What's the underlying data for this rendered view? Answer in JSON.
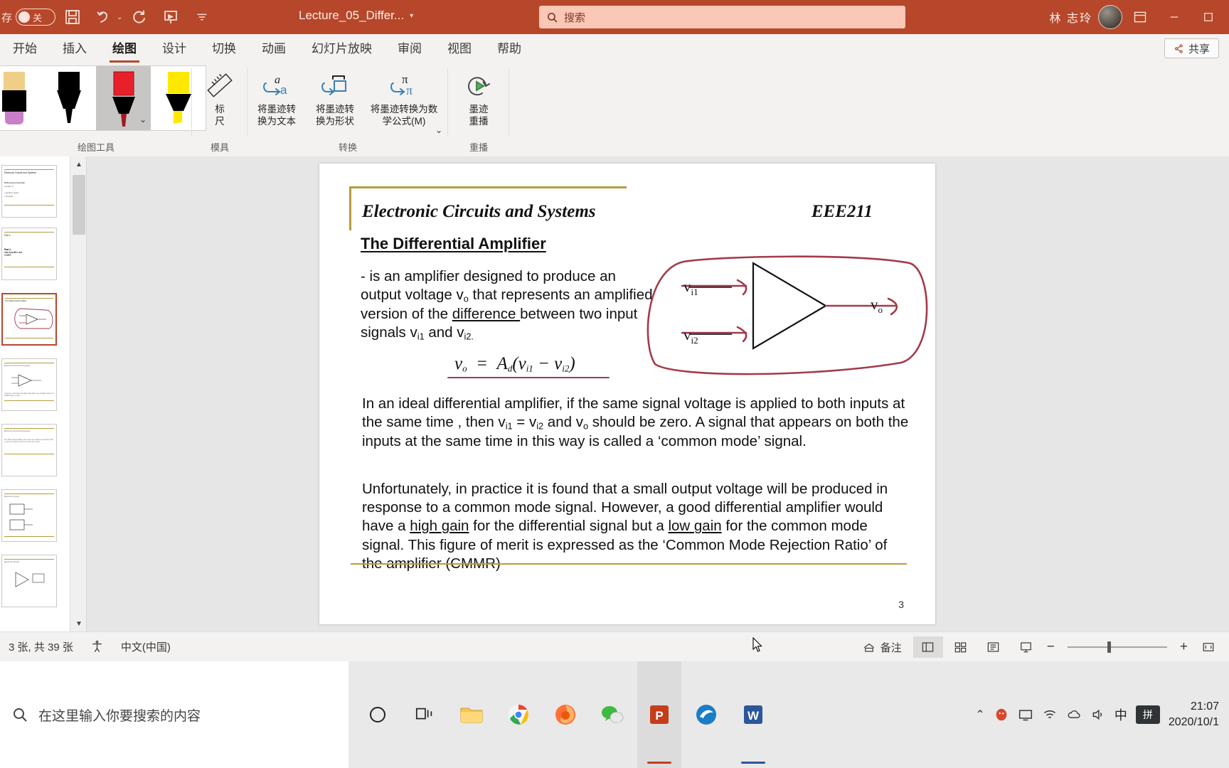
{
  "titlebar": {
    "autosave_label": "存",
    "autosave_state": "关",
    "doc_title": "Lecture_05_Differ...",
    "search_placeholder": "搜索",
    "user_name": "林 志玲",
    "icons": [
      "save-icon",
      "undo-icon",
      "redo-icon",
      "present-icon",
      "customize-qat-icon"
    ],
    "window_buttons": [
      "restore-ribbon",
      "minimize",
      "maximize"
    ]
  },
  "tabs": [
    {
      "label": "开始",
      "active": false
    },
    {
      "label": "插入",
      "active": false
    },
    {
      "label": "绘图",
      "active": true
    },
    {
      "label": "设计",
      "active": false
    },
    {
      "label": "切换",
      "active": false
    },
    {
      "label": "动画",
      "active": false
    },
    {
      "label": "幻灯片放映",
      "active": false
    },
    {
      "label": "审阅",
      "active": false
    },
    {
      "label": "视图",
      "active": false
    },
    {
      "label": "帮助",
      "active": false
    }
  ],
  "share_button": "共享",
  "ribbon": {
    "groups": [
      {
        "name": "绘图工具"
      },
      {
        "name": "模具"
      },
      {
        "name": "转换"
      },
      {
        "name": "重播"
      }
    ],
    "pens": [
      {
        "name": "eraser",
        "color": "#c97fc8",
        "selected": false
      },
      {
        "name": "black-pen",
        "color": "#000000",
        "selected": false
      },
      {
        "name": "red-pen",
        "color": "#e8202a",
        "selected": true
      },
      {
        "name": "yellow-highlighter",
        "color": "#ffe800",
        "selected": false
      }
    ],
    "buttons": [
      {
        "label": "标\n尺",
        "icon": "ruler-icon"
      },
      {
        "label": "将墨迹转\n换为文本",
        "icon": "ink-to-text-icon"
      },
      {
        "label": "将墨迹转\n换为形状",
        "icon": "ink-to-shape-icon"
      },
      {
        "label": "将墨迹转换为数\n学公式(M)",
        "icon": "ink-to-math-icon"
      },
      {
        "label": "墨迹\n重播",
        "icon": "ink-replay-icon"
      }
    ]
  },
  "slide": {
    "header_left": "Electronic Circuits and Systems",
    "header_right": "EEE211",
    "heading": "The Differential Amplifier",
    "para1_html": "- is an amplifier designed to produce an output voltage v<sub>o</sub> that represents an amplified version of the <span class=\"u\">difference </span>between two input signals v<sub>i1</sub> and v<sub>i2.</sub>",
    "formula_html": "v<sub>o</sub> &nbsp;= &nbsp;A<sub>d</sub>(v<sub>i1</sub> &minus; v<sub>i2</sub>)",
    "para2_html": "In an ideal differential amplifier, if the same signal voltage is applied to both inputs at the same time , then v<sub>i1</sub> = v<sub>i2</sub> and v<sub>o</sub> should be zero. A signal that appears on both the inputs at the same time in this way is called a &lsquo;common mode&rsquo; signal.",
    "para3_html": "Unfortunately, in practice it is found that a small output voltage will be produced in response to a common mode signal. However, a good differential amplifier would have a <span class=\"u\">high gain</span> for the differential signal but a <span class=\"u\">low gain</span> for the common mode signal. This figure of merit is expressed as the &lsquo;Common Mode Rejection Ratio&rsquo; of the amplifier (CMMR)",
    "page_number": "3",
    "ink_labels": [
      "v",
      "i1",
      "v",
      "i2",
      "v",
      "o"
    ],
    "accent_color": "#b79c3e",
    "ink_color": "#a33b4a"
  },
  "thumbnails": [
    {
      "index": 1,
      "title": "Electronic Circuits and Systems",
      "selected": false
    },
    {
      "index": 2,
      "title": "Part 1:",
      "subtitle": "Differential Amplifier and CMRR",
      "selected": false
    },
    {
      "index": 3,
      "title": "The Differential Amplifier",
      "selected": true
    },
    {
      "index": 4,
      "title": "",
      "selected": false
    },
    {
      "index": 5,
      "title": "",
      "selected": false
    },
    {
      "index": 6,
      "title": "",
      "selected": false
    },
    {
      "index": 7,
      "title": "",
      "selected": false
    }
  ],
  "status": {
    "slide_count": "3 张, 共 39 张",
    "accessibility_icon": "accessibility-icon",
    "language": "中文(中国)",
    "notes_label": "备注",
    "views": [
      "normal-view",
      "slide-sorter-view",
      "reading-view",
      "slideshow-view"
    ],
    "zoom_out": "−",
    "zoom_in": "+",
    "fit_icon": "fit-slide-icon"
  },
  "taskbar": {
    "search_placeholder": "在这里输入你要搜索的内容",
    "apps": [
      {
        "name": "cortana",
        "label": "Cortana"
      },
      {
        "name": "task-view",
        "label": "任务视图"
      },
      {
        "name": "file-explorer",
        "label": "文件资源管理器"
      },
      {
        "name": "chrome",
        "label": "Google Chrome"
      },
      {
        "name": "firefox",
        "label": "Firefox"
      },
      {
        "name": "wechat",
        "label": "微信"
      },
      {
        "name": "powerpoint",
        "label": "PowerPoint"
      },
      {
        "name": "edge-chromium",
        "label": "浏览器"
      },
      {
        "name": "word",
        "label": "Word"
      }
    ],
    "tray": {
      "ime_lang": "中",
      "ime_mode": "拼",
      "time": "21:07",
      "date": "2020/10/1"
    }
  }
}
